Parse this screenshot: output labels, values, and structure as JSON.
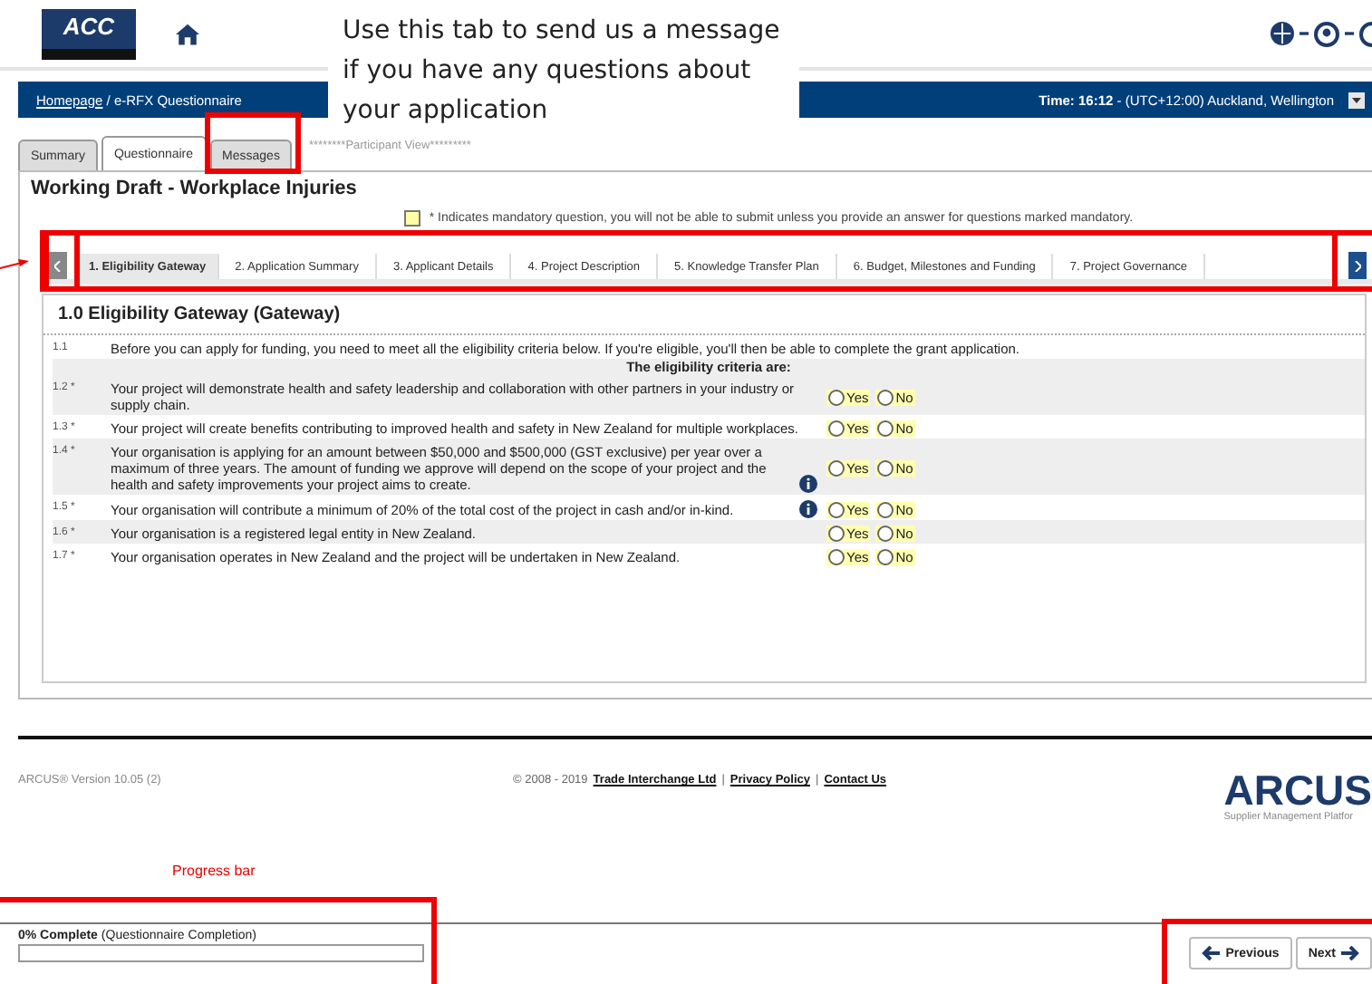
{
  "header": {
    "logo": "ACC"
  },
  "nav_bar": {
    "breadcrumb_link": "Homepage",
    "breadcrumb_rest": " / e-RFX Questionnaire",
    "time_label": "Time: 16:12",
    "timezone": " - (UTC+12:00) Auckland, Wellington"
  },
  "tabs": [
    {
      "label": "Summary",
      "selected": false
    },
    {
      "label": "Questionnaire",
      "selected": true
    },
    {
      "label": "Messages",
      "selected": false
    }
  ],
  "view_label": "********Participant View*********",
  "title": "Working Draft - Workplace Injuries",
  "mandatory_note": "* Indicates mandatory question, you will not be able to submit unless you provide an answer for questions marked mandatory.",
  "section_tabs": [
    {
      "label": "1. Eligibility Gateway",
      "selected": true
    },
    {
      "label": "2. Application Summary",
      "selected": false
    },
    {
      "label": "3. Applicant Details",
      "selected": false
    },
    {
      "label": "4. Project Description",
      "selected": false
    },
    {
      "label": "5. Knowledge Transfer Plan",
      "selected": false
    },
    {
      "label": "6. Budget, Milestones and Funding",
      "selected": false
    },
    {
      "label": "7. Project Governance",
      "selected": false
    }
  ],
  "section": {
    "heading": "1.0 Eligibility Gateway (Gateway)",
    "intro": {
      "number": "1.1",
      "text": "Before you can apply for funding, you need to meet all the eligibility criteria below. If you're eligible, you'll then be able to complete the grant application."
    },
    "criteria_heading": "The eligibility criteria are:",
    "questions": [
      {
        "number": "1.2 *",
        "text": "Your project will demonstrate health and safety leadership and collaboration with other partners in your industry or supply chain.",
        "info": false,
        "options": [
          {
            "label": "Yes",
            "selected": false
          },
          {
            "label": "No",
            "selected": false
          }
        ]
      },
      {
        "number": "1.3 *",
        "text": "Your project will create benefits contributing to improved health and safety in New Zealand for multiple workplaces.",
        "info": false,
        "options": [
          {
            "label": "Yes",
            "selected": false
          },
          {
            "label": "No",
            "selected": false
          }
        ]
      },
      {
        "number": "1.4 *",
        "text": "Your organisation is applying for an amount between $50,000 and $500,000 (GST exclusive) per year over a maximum of three years. The amount of funding we approve will depend on the scope of your project and the health and safety improvements your project aims to create.",
        "info": true,
        "options": [
          {
            "label": "Yes",
            "selected": false
          },
          {
            "label": "No",
            "selected": false
          }
        ]
      },
      {
        "number": "1.5 *",
        "text": "Your organisation will contribute a minimum of 20% of the total cost of the project in cash and/or in-kind.",
        "info": true,
        "options": [
          {
            "label": "Yes",
            "selected": false
          },
          {
            "label": "No",
            "selected": false
          }
        ]
      },
      {
        "number": "1.6 *",
        "text": "Your organisation is a registered legal entity in New Zealand.",
        "info": false,
        "options": [
          {
            "label": "Yes",
            "selected": false
          },
          {
            "label": "No",
            "selected": false
          }
        ]
      },
      {
        "number": "1.7 *",
        "text": "Your organisation operates in New Zealand and the project will be undertaken in New Zealand.",
        "info": false,
        "options": [
          {
            "label": "Yes",
            "selected": false
          },
          {
            "label": "No",
            "selected": false
          }
        ]
      }
    ]
  },
  "footer": {
    "version": "ARCUS® Version 10.05 (2)",
    "copyright": "© 2008 - 2019",
    "items": [
      {
        "kind": "link",
        "text": "Trade Interchange Ltd"
      },
      {
        "kind": "separator",
        "text": "|"
      },
      {
        "kind": "link",
        "text": "Privacy Policy"
      },
      {
        "kind": "separator",
        "text": "|"
      },
      {
        "kind": "link",
        "text": "Contact Us"
      }
    ],
    "logo": "ARCUS",
    "logo_tagline": "Supplier Management Platfor"
  },
  "progress": {
    "percent": "0% Complete",
    "caption": "(Questionnaire Completion)",
    "level": 0
  },
  "buttons": [
    {
      "label": "Previous",
      "kind": "previous"
    },
    {
      "label": "Next",
      "kind": "next"
    }
  ],
  "annotations": {
    "callout": "Use this tab to send us a message if you have any questions about your application",
    "progress_label": "Progress bar"
  }
}
